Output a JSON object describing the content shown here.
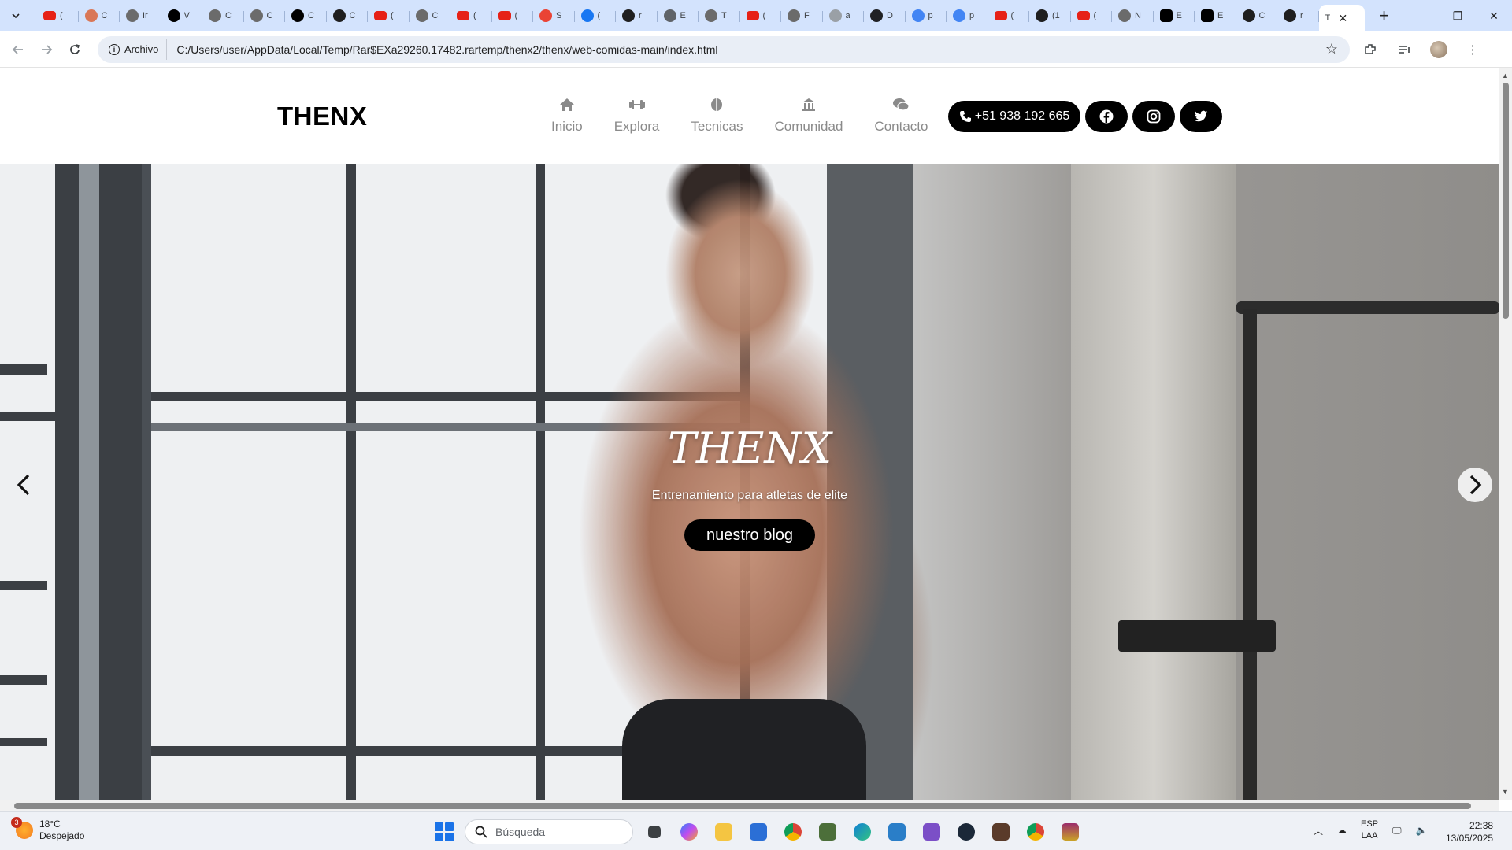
{
  "browser": {
    "tabs": [
      {
        "title": "(",
        "icon": "youtube-icon",
        "color": "#e62117"
      },
      {
        "title": "C",
        "icon": "claude-icon",
        "color": "#d97757"
      },
      {
        "title": "Ir",
        "icon": "chatgpt-icon",
        "color": "#6b6b6b"
      },
      {
        "title": "V",
        "icon": "threads-icon",
        "color": "#000000"
      },
      {
        "title": "C",
        "icon": "chatgpt-icon",
        "color": "#6b6b6b"
      },
      {
        "title": "C",
        "icon": "chatgpt-icon",
        "color": "#6b6b6b"
      },
      {
        "title": "C",
        "icon": "threads-icon",
        "color": "#000000"
      },
      {
        "title": "C",
        "icon": "loading-icon",
        "color": "#1f1f1f"
      },
      {
        "title": "(",
        "icon": "youtube-icon",
        "color": "#e62117"
      },
      {
        "title": "C",
        "icon": "chatgpt-icon",
        "color": "#6b6b6b"
      },
      {
        "title": "(",
        "icon": "youtube-icon",
        "color": "#e62117"
      },
      {
        "title": "(",
        "icon": "youtube-icon",
        "color": "#e62117"
      },
      {
        "title": "S",
        "icon": "gmail-icon",
        "color": "#ea4335"
      },
      {
        "title": "(",
        "icon": "facebook-icon",
        "color": "#1877f2"
      },
      {
        "title": "r",
        "icon": "github-icon",
        "color": "#1f1f1f"
      },
      {
        "title": "E",
        "icon": "globe-icon",
        "color": "#5f6368"
      },
      {
        "title": "T",
        "icon": "chatgpt-icon",
        "color": "#6b6b6b"
      },
      {
        "title": "(",
        "icon": "youtube-icon",
        "color": "#e62117"
      },
      {
        "title": "F",
        "icon": "chatgpt-icon",
        "color": "#6b6b6b"
      },
      {
        "title": "a",
        "icon": "globe-icon",
        "color": "#9aa0a6"
      },
      {
        "title": "D",
        "icon": "hexagon-icon",
        "color": "#202124"
      },
      {
        "title": "p",
        "icon": "google-icon",
        "color": "#4285f4"
      },
      {
        "title": "p",
        "icon": "google-icon",
        "color": "#4285f4"
      },
      {
        "title": "(",
        "icon": "youtube-icon",
        "color": "#e62117"
      },
      {
        "title": "(1",
        "icon": "speaker-icon",
        "color": "#1f1f1f"
      },
      {
        "title": "(",
        "icon": "youtube-icon",
        "color": "#e62117"
      },
      {
        "title": "N",
        "icon": "chatgpt-icon",
        "color": "#6b6b6b"
      },
      {
        "title": "E",
        "icon": "notion-icon",
        "color": "#000000"
      },
      {
        "title": "E",
        "icon": "hr-icon",
        "color": "#000000"
      },
      {
        "title": "C",
        "icon": "github-icon",
        "color": "#1f1f1f"
      },
      {
        "title": "r",
        "icon": "github-icon",
        "color": "#1f1f1f"
      }
    ],
    "active_tab": {
      "title": "T"
    },
    "site_chip": "Archivo",
    "url": "C:/Users/user/AppData/Local/Temp/Rar$EXa29260.17482.rartemp/thenx2/thenx/web-comidas-main/index.html"
  },
  "site": {
    "logo": "THENX",
    "nav": [
      {
        "label": "Inicio",
        "icon": "home-icon"
      },
      {
        "label": "Explora",
        "icon": "dumbbell-icon"
      },
      {
        "label": "Tecnicas",
        "icon": "leaf-icon"
      },
      {
        "label": "Comunidad",
        "icon": "landmark-icon"
      },
      {
        "label": "Contacto",
        "icon": "comments-icon"
      }
    ],
    "phone": "+51 938 192 665",
    "social": [
      "facebook-icon",
      "instagram-icon",
      "twitter-icon"
    ]
  },
  "hero": {
    "title": "THENX",
    "subtitle": "Entrenamiento para atletas de elite",
    "button": "nuestro blog"
  },
  "taskbar": {
    "weather_temp": "18°C",
    "weather_desc": "Despejado",
    "weather_badge": "3",
    "search_placeholder": "Búsqueda",
    "lang_1": "ESP",
    "lang_2": "LAA",
    "time": "22:38",
    "date": "13/05/2025"
  },
  "colors": {
    "tabbar_bg": "#d3e3fd",
    "button_black": "#000000",
    "nav_gray": "#8a8a8a"
  }
}
